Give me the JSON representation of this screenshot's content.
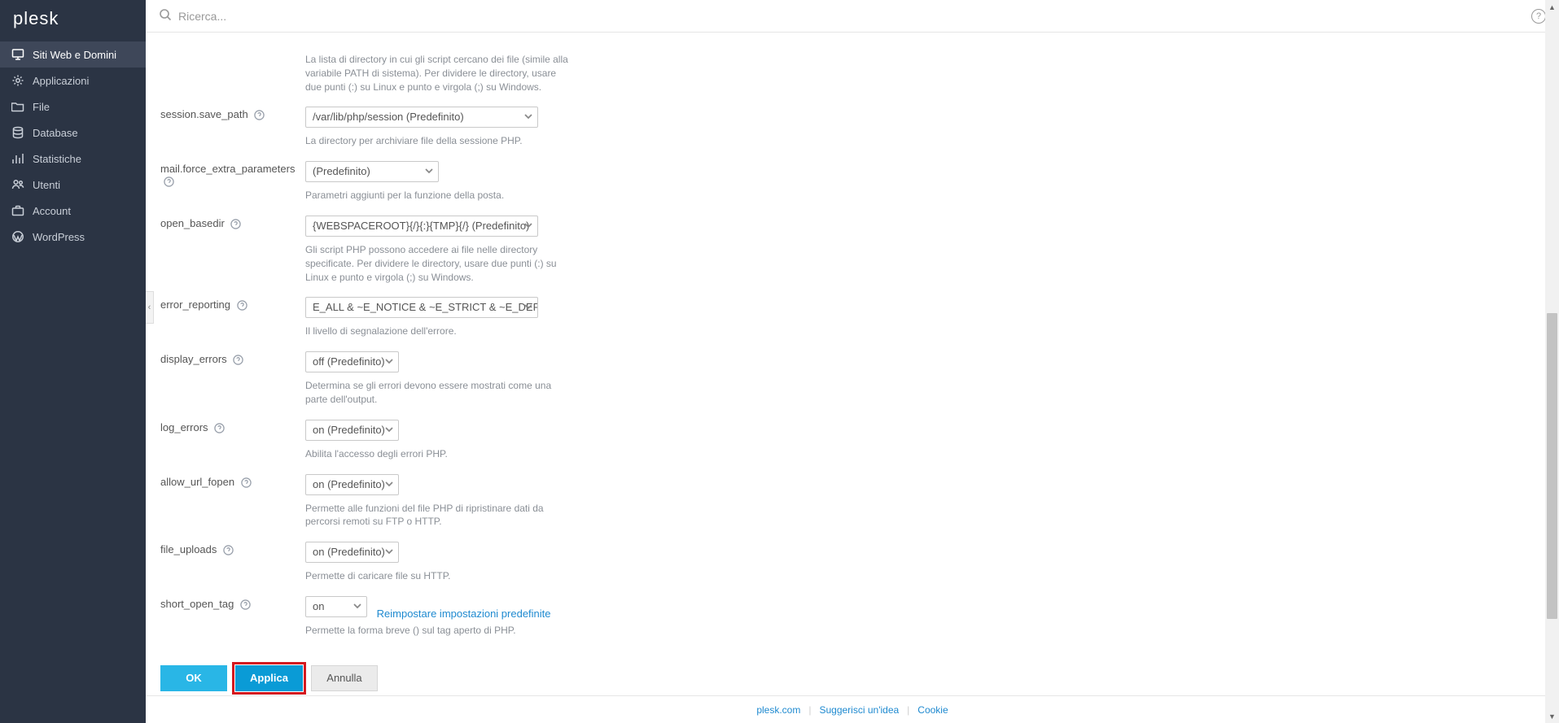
{
  "logo": "plesk",
  "search": {
    "placeholder": "Ricerca..."
  },
  "sidebar": {
    "items": [
      {
        "label": "Siti Web e Domini",
        "active": true
      },
      {
        "label": "Applicazioni"
      },
      {
        "label": "File"
      },
      {
        "label": "Database"
      },
      {
        "label": "Statistiche"
      },
      {
        "label": "Utenti"
      },
      {
        "label": "Account"
      },
      {
        "label": "WordPress"
      }
    ]
  },
  "settings": [
    {
      "name": "",
      "hint": "La lista di directory in cui gli script cercano dei file (simile alla variabile PATH di sistema). Per dividere le directory, usare due punti (:) su Linux e punto e virgola (;) su Windows.",
      "noLabel": true
    },
    {
      "name": "session.save_path",
      "value": "/var/lib/php/session (Predefinito)",
      "hint": "La directory per archiviare file della sessione PHP.",
      "width": "w-md"
    },
    {
      "name": "mail.force_extra_parameters",
      "value": "(Predefinito)",
      "hint": "Parametri aggiunti per la funzione della posta.",
      "width": "w-sm"
    },
    {
      "name": "open_basedir",
      "value": "{WEBSPACEROOT}{/}{:}{TMP}{/} (Predefinito)",
      "hint": "Gli script PHP possono accedere ai file nelle directory specificate. Per dividere le directory, usare due punti (:) su Linux e punto e virgola (;) su Windows.",
      "width": "w-md"
    },
    {
      "name": "error_reporting",
      "value": "E_ALL & ~E_NOTICE & ~E_STRICT & ~E_DEPRECA",
      "hint": "Il livello di segnalazione dell'errore.",
      "width": "w-md"
    },
    {
      "name": "display_errors",
      "value": "off (Predefinito)",
      "hint": "Determina se gli errori devono essere mostrati come una parte dell'output.",
      "width": "w-sm2"
    },
    {
      "name": "log_errors",
      "value": "on (Predefinito)",
      "hint": "Abilita l'accesso degli errori PHP.",
      "width": "w-sm2"
    },
    {
      "name": "allow_url_fopen",
      "value": "on (Predefinito)",
      "hint": "Permette alle funzioni del file PHP di ripristinare dati da percorsi remoti su FTP o HTTP.",
      "width": "w-sm2"
    },
    {
      "name": "file_uploads",
      "value": "on (Predefinito)",
      "hint": "Permette di caricare file su HTTP.",
      "width": "w-sm2"
    },
    {
      "name": "short_open_tag",
      "value": "on",
      "hint": "Permette la forma breve () sul tag aperto di PHP.",
      "width": "w-xs",
      "reset": "Reimpostare impostazioni predefinite"
    }
  ],
  "buttons": {
    "ok": "OK",
    "apply": "Applica",
    "cancel": "Annulla"
  },
  "footer": {
    "a": "plesk.com",
    "b": "Suggerisci un'idea",
    "c": "Cookie"
  }
}
